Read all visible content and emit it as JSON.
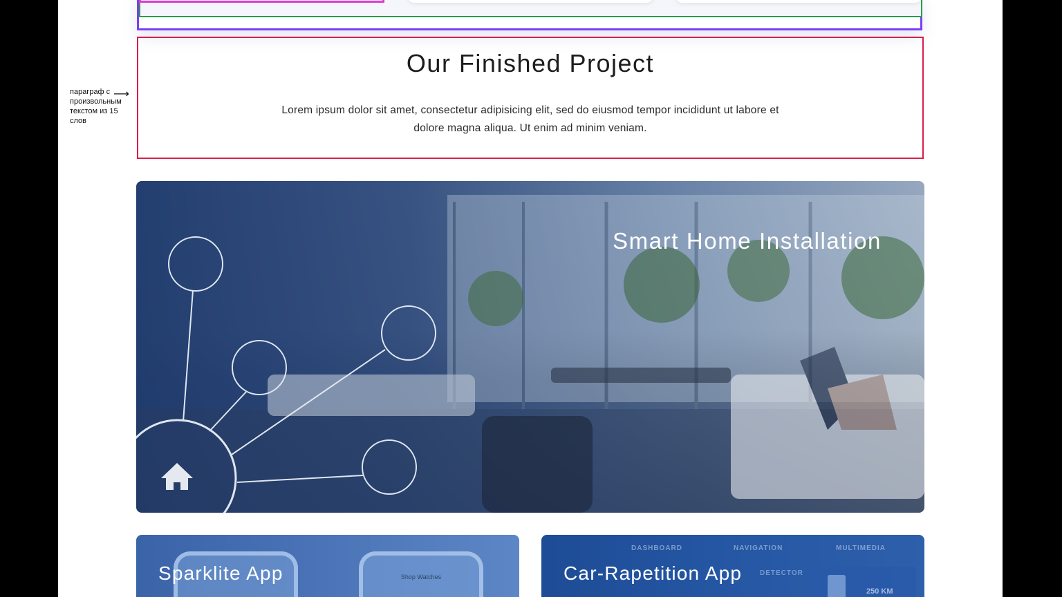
{
  "annotation": {
    "text": "параграф с произвольным текстом из 15 слов",
    "arrow": "⟶"
  },
  "section": {
    "title": "Our Finished Project",
    "paragraph": "Lorem ipsum dolor sit amet, consectetur adipisicing elit, sed do eiusmod tempor incididunt ut labore et dolore magna aliqua. Ut enim ad minim veniam."
  },
  "hero": {
    "title": "Smart Home Installation",
    "icon": "home-icon"
  },
  "cards": {
    "left": {
      "title": "Sparklite App",
      "phone_label": "Shop Watches"
    },
    "right": {
      "title": "Car-Rapetition App",
      "tabs": [
        "DASHBOARD",
        "NAVIGATION",
        "MULTIMEDIA"
      ],
      "detector_label": "DETECTOR",
      "readout": "250 KM"
    }
  },
  "colors": {
    "outline_purple": "#7b3ff2",
    "outline_green": "#2b9b49",
    "outline_magenta": "#e23bd5",
    "section_frame": "#d81e4a",
    "hero_overlay": "#1d396c"
  }
}
